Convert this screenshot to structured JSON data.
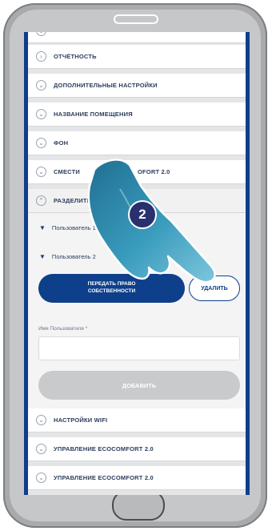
{
  "menu": {
    "reports": "ОТЧЁТНОСТЬ",
    "advanced_settings": "ДОПОЛНИТЕЛЬНЫЕ НАСТРОЙКИ",
    "room_name": "НАЗВАНИЕ ПОМЕЩЕНИЯ",
    "background": "ФОН",
    "move_part1": "СМЕСТИ",
    "move_part2": "OFORT 2.0",
    "share_section": "РАЗДЕЛИТЕ",
    "wifi_settings": "НАСТРОЙКИ WIFI",
    "manage_1": "УПРАВЛЕНИЕ ECOCOMFORT 2.0",
    "manage_2": "УПРАВЛЕНИЕ ECOCOMFORT 2.0"
  },
  "users": {
    "user_1": "Пользователь 1",
    "user_2": "Пользователь 2"
  },
  "actions": {
    "transfer_line1": "ПЕРЕДАТЬ ПРАВО",
    "transfer_line2": "СОБСТВЕННОСТИ",
    "delete": "УДАЛИТЬ",
    "add": "ДОБАВИТЬ"
  },
  "form": {
    "username_label": "Имя Пользователя *",
    "username_value": ""
  },
  "overlay": {
    "step_number": "2"
  },
  "icons": {
    "collapsed_chevron": "chevron-right-icon",
    "expanded_chevron": "chevron-down-icon",
    "collapse_chevron": "chevron-up-icon",
    "pointer": "pointing-hand-icon"
  },
  "colors": {
    "brand_blue": "#0d3f8a",
    "disabled_gray": "#c9cacc",
    "badge": "#2a2f6e",
    "hand": "#2f8fb0"
  }
}
